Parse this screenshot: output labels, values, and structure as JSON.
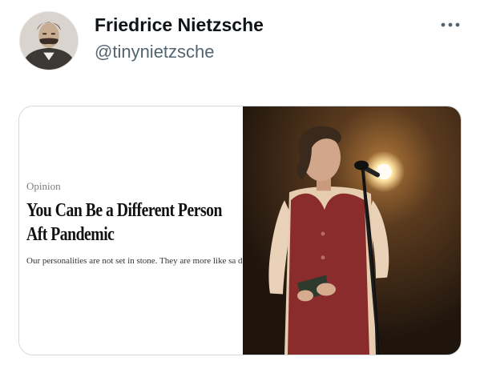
{
  "tweet": {
    "author": {
      "display_name": "Friedrice Nietzsche",
      "handle": "@tinynietzsche",
      "avatar_icon": "portrait-avatar"
    },
    "more_icon": "more-horizontal-icon",
    "link_card": {
      "kicker": "Opinion",
      "headline": "You Can Be a Different Person Aft Pandemic",
      "summary": "Our personalities are not set in stone. They are more like sa dunes.",
      "image_icon": "performer-at-microphone-photo"
    }
  },
  "colors": {
    "text_primary": "#0f1419",
    "text_secondary": "#536471",
    "card_border": "#cfd9de",
    "vest": "#8a2c2c",
    "stage_background": "#2b1d12"
  }
}
